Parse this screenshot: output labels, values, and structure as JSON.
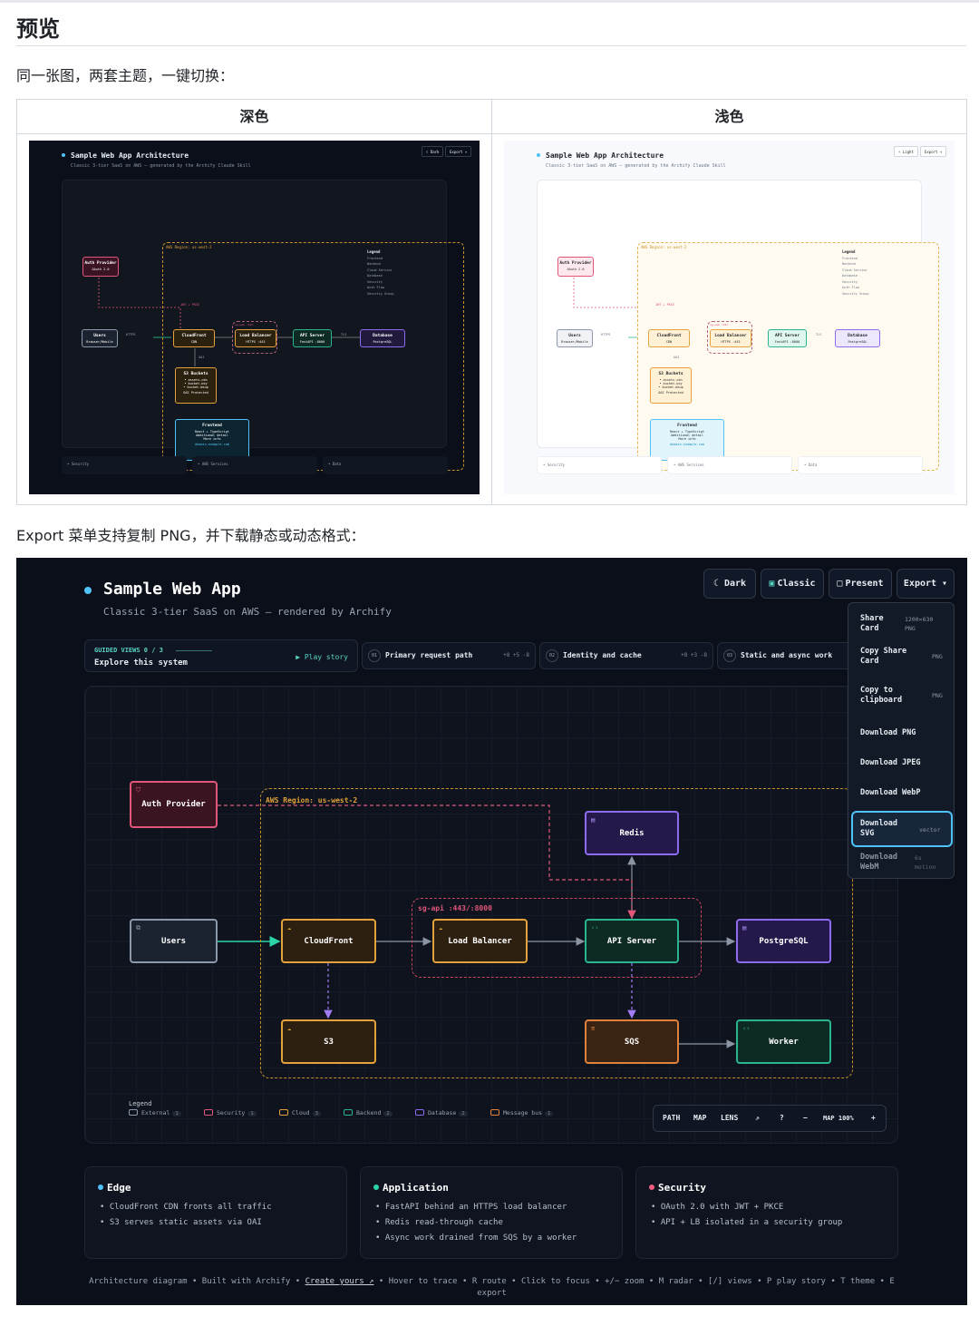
{
  "heading": "预览",
  "intro": "同一张图，两套主题，一键切换：",
  "table": {
    "col_dark": "深色",
    "col_light": "浅色"
  },
  "thumb": {
    "title": "Sample Web App Architecture",
    "subtitle": "Classic 3-tier SaaS on AWS — generated by the Archify Claude Skill",
    "dark_btn": "☾ Dark",
    "light_btn": "☼ Light",
    "export_btn": "Export ▾",
    "region_label": "AWS Region: us-west-2",
    "sg_label": "sg-web :443",
    "nodes": {
      "auth": "Auth Provider",
      "auth_sub": "OAuth 2.0",
      "users": "Users",
      "users_sub": "Browser/Mobile",
      "cloudfront": "CloudFront",
      "cloudfront_sub": "CDN",
      "lb": "Load Balancer",
      "lb_sub": "HTTPS :443",
      "api": "API Server",
      "api_sub": "FastAPI :8000",
      "db": "Database",
      "db_sub": "PostgreSQL",
      "s3": "S3 Buckets",
      "s3_sub": "• assets-cdn\n• bucket-key\n• bucket-bkup",
      "s3_foot": "OAI Protected",
      "fe": "Frontend",
      "fe_sub": "React + TypeScript\nAdditional detail\nMore info",
      "fe_foot": "domain.example.com"
    },
    "edges": {
      "jwt": "JWT + PKCE",
      "https": "HTTPS",
      "tls": "TLS",
      "oai": "OAI"
    },
    "legend_title": "Legend",
    "legend": [
      "Frontend",
      "Backend",
      "Cloud Service",
      "Database",
      "Security",
      "Auth Flow",
      "Security Group"
    ],
    "bottom_labels": [
      "• Security",
      "• AWS Services",
      "• Data"
    ]
  },
  "export_intro": "Export 菜单支持复制 PNG，并下载静态或动态格式：",
  "app": {
    "title": "Sample Web App",
    "subtitle": "Classic 3-tier SaaS on AWS — rendered by Archify",
    "buttons": {
      "dark": "☾ Dark",
      "classic": "Classic",
      "present": "Present",
      "export": "Export ▾"
    },
    "guided": {
      "label": "GUIDED VIEWS  0 / 3",
      "title": "Explore this system",
      "play": "▶ Play story"
    },
    "views": [
      {
        "num": "01",
        "label": "Primary request path",
        "meta": "+8 +5 -8"
      },
      {
        "num": "02",
        "label": "Identity and cache",
        "meta": "+8 +3 -8"
      },
      {
        "num": "03",
        "label": "Static and async work",
        "meta": ""
      }
    ],
    "region_label": "AWS Region: us-west-2",
    "sg_label": "sg-api :443/:8000",
    "nodes": {
      "auth": "Auth Provider",
      "users": "Users",
      "cloudfront": "CloudFront",
      "lb": "Load Balancer",
      "api": "API Server",
      "postgres": "PostgreSQL",
      "redis": "Redis",
      "s3": "S3",
      "sqs": "SQS",
      "worker": "Worker"
    },
    "legend_title": "Legend",
    "legend": [
      {
        "label": "External",
        "count": "1",
        "color": "#8b98a9"
      },
      {
        "label": "Security",
        "count": "1",
        "color": "#e0577a"
      },
      {
        "label": "Cloud",
        "count": "3",
        "color": "#e3a23b"
      },
      {
        "label": "Backend",
        "count": "2",
        "color": "#2bb58f"
      },
      {
        "label": "Database",
        "count": "2",
        "color": "#8e6cf0"
      },
      {
        "label": "Message bus",
        "count": "1",
        "color": "#e0823b"
      }
    ],
    "controls": {
      "path": "PATH",
      "map": "MAP",
      "lens": "LENS",
      "pin": "⇗",
      "help": "?",
      "minus": "−",
      "zoom": "MAP 100%",
      "plus": "+"
    },
    "export_menu": [
      {
        "label": "Share\nCard",
        "meta": "1200×630\nPNG"
      },
      {
        "label": "Copy Share\nCard",
        "meta": "PNG"
      },
      {
        "label": "Copy to\nclipboard",
        "meta": "PNG"
      },
      {
        "label": "Download PNG",
        "meta": ""
      },
      {
        "label": "Download JPEG",
        "meta": ""
      },
      {
        "label": "Download WebP",
        "meta": ""
      },
      {
        "label": "Download\nSVG",
        "meta": "vector"
      },
      {
        "label": "Download\nWebM",
        "meta": "6s\nmotion"
      }
    ],
    "cards": [
      {
        "title": "Edge",
        "color": "#4fc3f7",
        "lines": [
          "• CloudFront CDN fronts all traffic",
          "• S3 serves static assets via OAI"
        ]
      },
      {
        "title": "Application",
        "color": "#2bd4a4",
        "lines": [
          "• FastAPI behind an HTTPS load balancer",
          "• Redis read-through cache",
          "• Async work drained from SQS by a worker"
        ]
      },
      {
        "title": "Security",
        "color": "#f05d7e",
        "lines": [
          "• OAuth 2.0 with JWT + PKCE",
          "• API + LB isolated in a security group"
        ]
      }
    ],
    "footer_pre": "Architecture diagram • Built with Archify • ",
    "footer_link": "Create yours ↗",
    "footer_post": " • Hover to trace • R route • Click to focus • +/− zoom • M radar • [/] views • P play story • T theme • E",
    "footer_line2": "export"
  },
  "colors": {
    "dark_bg": "#0b0f1a",
    "accent": "#4fc3f7",
    "light_bg": "#f7f9fc"
  }
}
